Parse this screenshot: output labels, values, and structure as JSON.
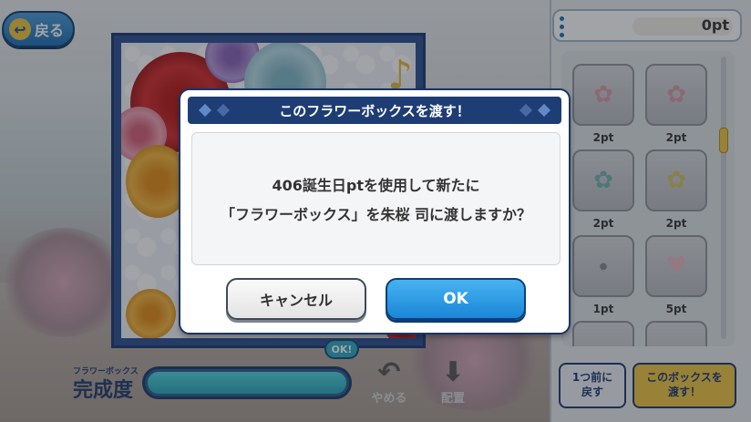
{
  "header": {
    "back_label": "戻る",
    "points": "0pt"
  },
  "dialog": {
    "title": "このフラワーボックスを渡す！",
    "message_line1": "406誕生日ptを使用して新たに",
    "message_line2": "「フラワーボックス」を朱桜 司に渡しますか？",
    "cancel_label": "キャンセル",
    "ok_label": "OK"
  },
  "items": [
    {
      "label": "2pt",
      "icon": "flower-pink-icon",
      "color": "#d99aa8"
    },
    {
      "label": "2pt",
      "icon": "flower-pink-icon",
      "color": "#d99aa8"
    },
    {
      "label": "2pt",
      "icon": "flower-teal-icon",
      "color": "#6fb3b0"
    },
    {
      "label": "2pt",
      "icon": "flower-yellow-icon",
      "color": "#d7c15a"
    },
    {
      "label": "1pt",
      "icon": "pearl-icon",
      "color": "#888888"
    },
    {
      "label": "5pt",
      "icon": "heart-beads-icon",
      "color": "#e6b8c2"
    }
  ],
  "bottom": {
    "progress_small_label": "フラワーボックス",
    "progress_label": "完成度",
    "progress_value": 1.0,
    "ok_badge": "OK!",
    "quit_label": "やめる",
    "arrange_label": "配置"
  },
  "right_buttons": {
    "prev_label": "1つ前に\n戻す",
    "give_label": "このボックスを\n渡す！"
  },
  "colors": {
    "primary": "#1e3d74",
    "ok_blue": "#1a86d8",
    "gold": "#f0c63f"
  }
}
